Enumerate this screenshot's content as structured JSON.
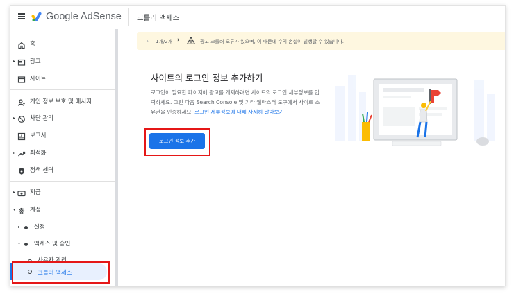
{
  "app": {
    "brand": "Google AdSense",
    "page_title": "크롤러 액세스"
  },
  "sidebar": {
    "items": [
      {
        "label": "홈",
        "icon": "home-icon"
      },
      {
        "label": "광고",
        "icon": "ads-icon"
      },
      {
        "label": "사이트",
        "icon": "sites-icon"
      },
      {
        "label": "개인 정보 보호 및 메시지",
        "icon": "privacy-icon"
      },
      {
        "label": "차단 관리",
        "icon": "block-icon"
      },
      {
        "label": "보고서",
        "icon": "reports-icon"
      },
      {
        "label": "최적화",
        "icon": "optimize-icon"
      },
      {
        "label": "정책 센터",
        "icon": "policy-icon"
      },
      {
        "label": "지급",
        "icon": "payments-icon"
      },
      {
        "label": "계정",
        "icon": "gear-icon"
      },
      {
        "label": "설정"
      },
      {
        "label": "액세스 및 승인"
      },
      {
        "label": "사용자 관리"
      },
      {
        "label": "크롤러 액세스"
      }
    ]
  },
  "banner": {
    "pager": "1개/2개",
    "message": "광고 크롤러 오류가 있으며, 이 때문에 수익 손실이 발생할 수 있습니다."
  },
  "main": {
    "headline": "사이트의 로그인 정보 추가하기",
    "description": "로그인이 필요한 페이지에 광고를 게재하려면 사이트의 로그인 세부정보를 입력하세요. 그런 다음 Search Console 및 기타 웹마스터 도구에서 사이트 소유권을 인증하세요.",
    "learn_more": "로그인 세부정보에 대해 자세히 알아보기",
    "add_button": "로그인 정보 추가"
  },
  "colors": {
    "accent": "#1a73e8",
    "banner_bg": "#fef7e0",
    "highlight": "#e51717",
    "active_nav_bg": "#e8f0fe"
  }
}
